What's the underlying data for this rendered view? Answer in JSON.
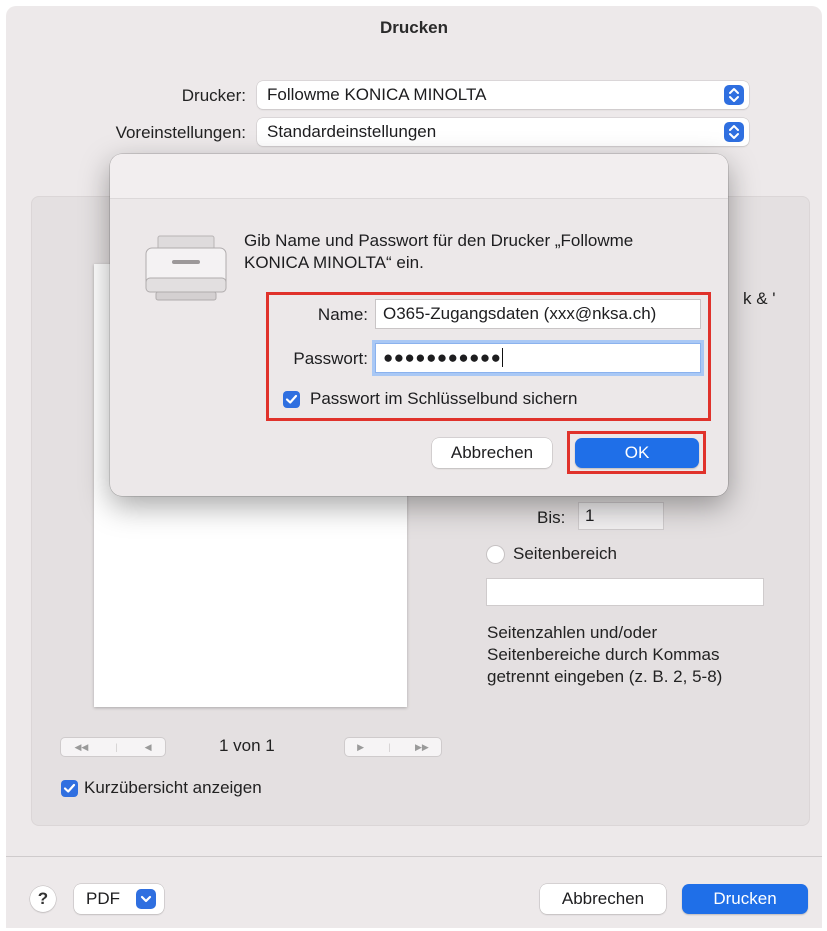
{
  "window": {
    "title": "Drucken"
  },
  "printer": {
    "label": "Drucker:",
    "value": "Followme KONICA MINOLTA"
  },
  "presets": {
    "label": "Voreinstellungen:",
    "value": "Standardeinstellungen"
  },
  "partial_label": "k & '",
  "pages": {
    "to_label": "Bis:",
    "to_value": "1",
    "range_label": "Seitenbereich",
    "range_value": "",
    "help_line1": "Seitenzahlen und/oder",
    "help_line2": "Seitenbereiche durch Kommas",
    "help_line3": "getrennt eingeben (z. B. 2, 5-8)"
  },
  "preview_nav": {
    "page_indicator": "1 von 1"
  },
  "thumbnail_toggle": {
    "label": "Kurzübersicht anzeigen",
    "checked": true
  },
  "footer": {
    "help": "?",
    "pdf": "PDF",
    "cancel": "Abbrechen",
    "print": "Drucken"
  },
  "auth_sheet": {
    "message_line1": "Gib Name und Passwort für den Drucker „Followme",
    "message_line2": "KONICA MINOLTA“ ein.",
    "name_label": "Name:",
    "name_value": "O365-Zugangsdaten (xxx@nksa.ch)",
    "password_label": "Passwort:",
    "password_value": "●●●●●●●●●●●",
    "keychain_label": "Passwort im Schlüsselbund sichern",
    "keychain_checked": true,
    "cancel": "Abbrechen",
    "ok": "OK"
  },
  "colors": {
    "accent": "#1f6fe8",
    "highlight": "#e0322b"
  }
}
